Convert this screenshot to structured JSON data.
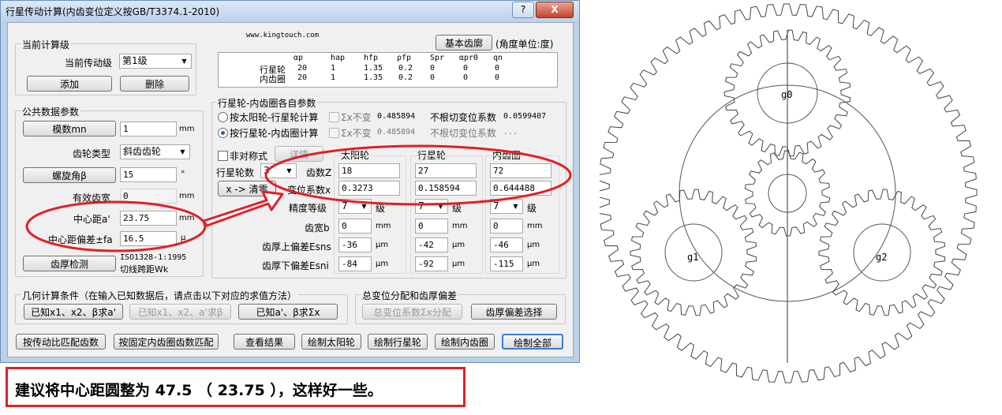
{
  "window": {
    "title": "行星传动计算(内齿变位定义按GB/T3374.1-2010)",
    "help_label": "?",
    "close_label": "X",
    "website": "www.kingtouch.com"
  },
  "current_stage": {
    "group_label": "当前计算级",
    "stage_label": "当前传动级",
    "stage_value": "第1级",
    "add_button": "添加",
    "delete_button": "删除"
  },
  "basic_profile": {
    "button": "基本齿廓",
    "angle_unit_note": "(角度单位:度)",
    "headers": [
      "αp",
      "hap",
      "hfp",
      "ρfp",
      "Spr",
      "αpr0",
      "qn"
    ],
    "rows": [
      {
        "name": "行星轮",
        "values": [
          "20",
          "1",
          "1.35",
          "0.2",
          "0",
          "0",
          "0"
        ]
      },
      {
        "name": "内齿圈",
        "values": [
          "20",
          "1",
          "1.35",
          "0.2",
          "0",
          "0",
          "0"
        ]
      }
    ]
  },
  "common_params": {
    "group_label": "公共数据参数",
    "module_button": "模数mn",
    "module_value": "1",
    "module_unit": "mm",
    "gear_type_label": "齿轮类型",
    "gear_type_value": "斜齿齿轮",
    "helix_button": "螺旋角β",
    "helix_value": "15",
    "helix_unit": "°",
    "face_width_label": "有效齿宽",
    "face_width_value": "0",
    "face_width_unit": "mm",
    "center_distance_label": "中心距a'",
    "center_distance_value": "23.75",
    "center_distance_unit": "mm",
    "deviation_label": "中心距偏差±fa",
    "deviation_value": "16.5",
    "deviation_unit": "μ",
    "tooth_check_button": "齿厚检测",
    "iso_line1": "ISO1328-1:1995",
    "iso_line2": "切线跨距Wk"
  },
  "self_params": {
    "group_label": "行星轮-内齿圈各自参数",
    "radio1": "按太阳轮-行星轮计算",
    "radio2": "按行星轮-内齿圈计算",
    "sum_label": "Σx不变",
    "sum_value1": "0.485894",
    "sum_value2": "0.485894",
    "undercut_label": "不根切变位系数",
    "undercut_value1": "0.0599407",
    "undercut_value2": "...",
    "asym_label": "非对称式",
    "detail_button": "详情",
    "planet_count_label": "行星轮数",
    "planet_count_value": "3",
    "clear_button": "x -> 清零",
    "col_sun": "太阳轮",
    "col_planet": "行星轮",
    "col_ring": "内齿圈",
    "teeth_label": "齿数Z",
    "teeth": [
      "18",
      "27",
      "72"
    ],
    "shift_label": "变位系数x",
    "shift": [
      "0.3273",
      "0.158594",
      "0.644488"
    ],
    "grade_label": "精度等级",
    "grades": [
      "7",
      "7",
      "7"
    ],
    "grade_unit": "级",
    "width_label": "齿宽b",
    "widths": [
      "0",
      "0",
      "0"
    ],
    "width_unit": "mm",
    "ess_label": "齿厚上偏差Esns",
    "ess": [
      "-36",
      "-42",
      "-46"
    ],
    "esi_label": "齿厚下偏差Esni",
    "esi": [
      "-84",
      "-92",
      "-115"
    ],
    "micro_unit": "μm"
  },
  "geometry": {
    "group_label": "几何计算条件（在输入已知数据后，请点击以下对应的求值方法）",
    "btn1": "已知x1、x2、β求a'",
    "btn2": "已知x1、x2、a'求β",
    "btn3": "已知a'、β求Σx"
  },
  "distribution": {
    "group_label": "总变位分配和齿厚偏差",
    "btn1": "总变位系数Σx分配",
    "btn2": "齿厚偏差选择"
  },
  "bottom_buttons": [
    "按传动比匹配齿数",
    "按固定内齿圈齿数匹配",
    "查看结果",
    "绘制太阳轮",
    "绘制行星轮",
    "绘制内齿圈",
    "绘制全部"
  ],
  "drawing": {
    "labels": [
      "g0",
      "g1",
      "g2"
    ]
  },
  "note": {
    "text": "建议将中心距圆整为 47.5 （ 23.75 ），这样好一些。"
  },
  "colors": {
    "annotation_red": "#e0202a"
  }
}
